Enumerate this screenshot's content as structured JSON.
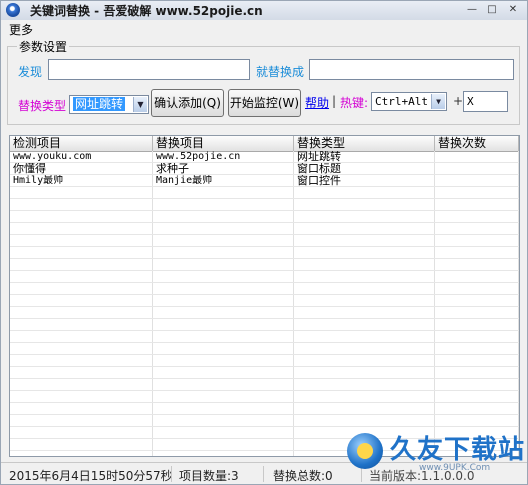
{
  "window": {
    "title": "关键词替换 - 吾爱破解 www.52pojie.cn",
    "controls": [
      "—",
      "□",
      "✕"
    ]
  },
  "menu": {
    "more": "更多"
  },
  "params": {
    "group_title": "参数设置",
    "find_label": "发现",
    "find_value": "",
    "replace_label": "就替换成",
    "replace_value": "",
    "type_label": "替换类型",
    "type_selected": "网址跳转",
    "confirm_button": "确认添加(Q)",
    "monitor_button": "开始监控(W)",
    "help_link": "帮助",
    "separator": "|",
    "hotkey_label": "热键:",
    "hotkey_modifier": "Ctrl+Alt",
    "plus": "+",
    "hotkey_key": "X"
  },
  "table": {
    "columns": [
      "检测项目",
      "替换项目",
      "替换类型",
      "替换次数"
    ],
    "rows": [
      [
        "www.youku.com",
        "www.52pojie.cn",
        "网址跳转",
        ""
      ],
      [
        "你懂得",
        "求种子",
        "窗口标题",
        ""
      ],
      [
        "Hmily最帅",
        "Manjie最帅",
        "窗口控件",
        ""
      ]
    ],
    "empty_row_count": 23
  },
  "status": {
    "time": "2015年6月4日15时50分57秒",
    "item_count": "项目数量:3",
    "replace_total": "替换总数:0",
    "version": "当前版本:1.1.0.0.0"
  },
  "watermark": {
    "name": "久友下载站",
    "url": "www.9UPK.Com"
  }
}
